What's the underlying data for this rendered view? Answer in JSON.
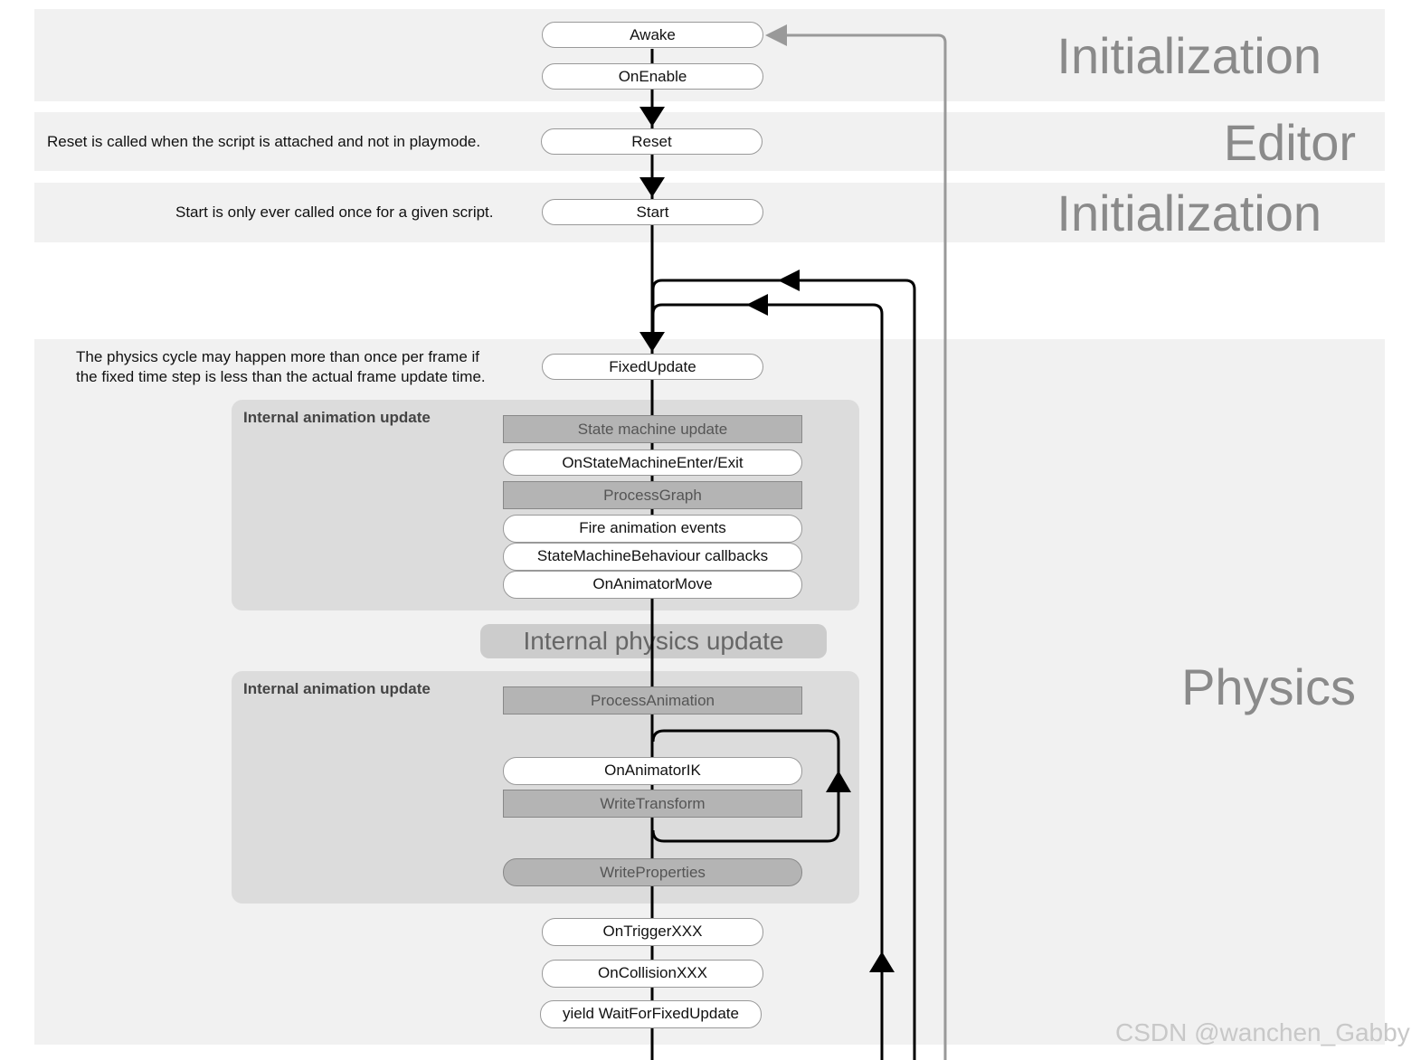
{
  "sections": {
    "init1": "Initialization",
    "editor": "Editor",
    "init2": "Initialization",
    "physics": "Physics"
  },
  "notes": {
    "reset": "Reset is called when the script is attached and not in playmode.",
    "start": "Start is only ever called once for a given script.",
    "physics_line1": "The physics cycle may happen more than once per frame if",
    "physics_line2": "the fixed time step is less than the actual frame update time."
  },
  "nodes": {
    "awake": "Awake",
    "onenable": "OnEnable",
    "reset": "Reset",
    "start": "Start",
    "fixedupdate": "FixedUpdate",
    "ontrigger": "OnTriggerXXX",
    "oncollision": "OnCollisionXXX",
    "yield": "yield WaitForFixedUpdate"
  },
  "anim_group1": {
    "label": "Internal animation update",
    "items": [
      "State machine update",
      "OnStateMachineEnter/Exit",
      "ProcessGraph",
      "Fire animation events",
      "StateMachineBehaviour callbacks",
      "OnAnimatorMove"
    ]
  },
  "internal_physics": "Internal physics update",
  "anim_group2": {
    "label": "Internal animation update",
    "items": [
      "ProcessAnimation",
      "OnAnimatorIK",
      "WriteTransform",
      "WriteProperties"
    ]
  },
  "watermark": "CSDN @wanchen_Gabby"
}
